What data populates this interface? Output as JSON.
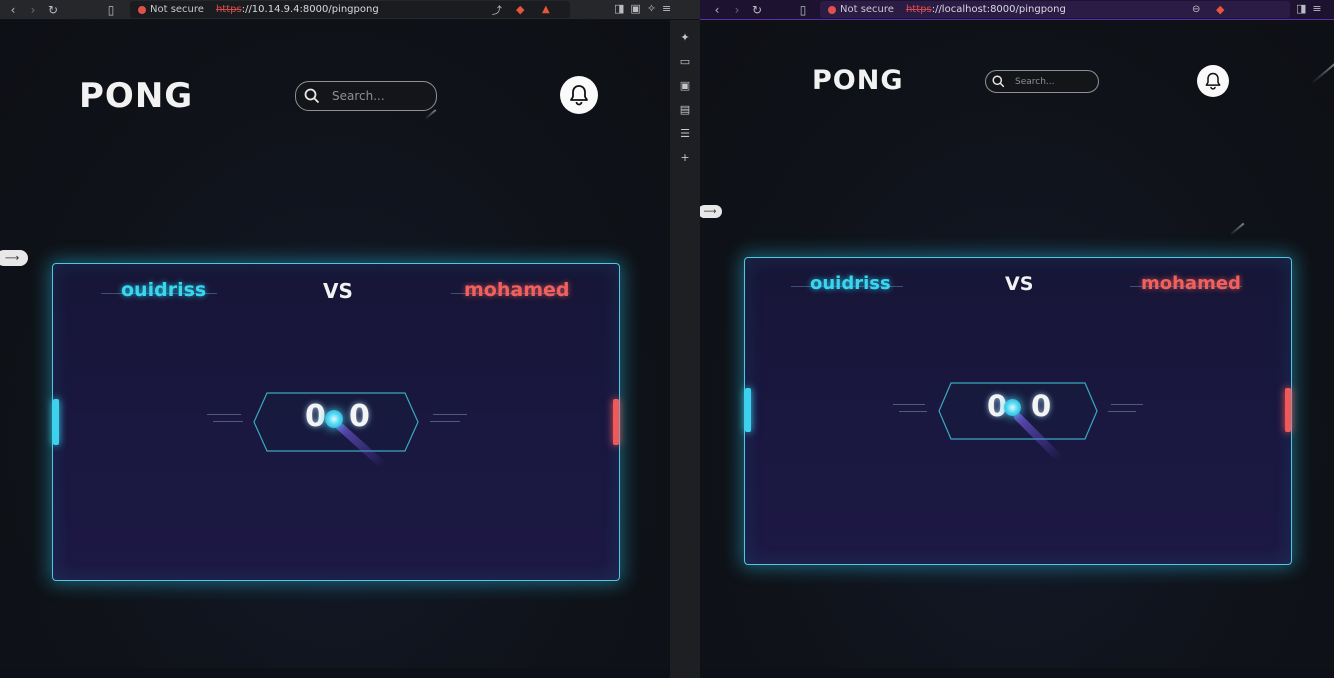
{
  "left_window": {
    "security_label": "Not secure",
    "url_scheme": "https",
    "url_rest": "://10.14.9.4:8000/pingpong",
    "logo": "PONG",
    "search_placeholder": "Search...",
    "player1": "ouidriss",
    "vs": "VS",
    "player2": "mohamed",
    "score_left": "0",
    "score_right": "0"
  },
  "right_window": {
    "security_label": "Not secure",
    "url_scheme": "https",
    "url_rest": "://localhost:8000/pingpong",
    "logo": "PONG",
    "search_placeholder": "Search...",
    "player1": "ouidriss",
    "vs": "VS",
    "player2": "mohamed",
    "score_left": "0",
    "score_right": "0"
  },
  "icons": {
    "back": "chevron-left-icon",
    "forward": "chevron-right-icon",
    "reload": "reload-icon",
    "bookmark": "bookmark-icon",
    "share": "share-icon",
    "brave": "brave-shield-icon",
    "warning": "warning-triangle-icon",
    "sidebar_toggle": "sidebar-icon",
    "wallet": "wallet-icon",
    "leo": "leo-ai-icon",
    "menu": "menu-icon",
    "zoom": "zoom-icon",
    "search": "search-icon",
    "bell": "bell-icon",
    "arrow": "arrow-right-icon"
  },
  "colors": {
    "player1": "#3ad6ef",
    "player2": "#f0615e",
    "board_border": "#53c7e0",
    "url_scheme": "#d24c4c"
  }
}
